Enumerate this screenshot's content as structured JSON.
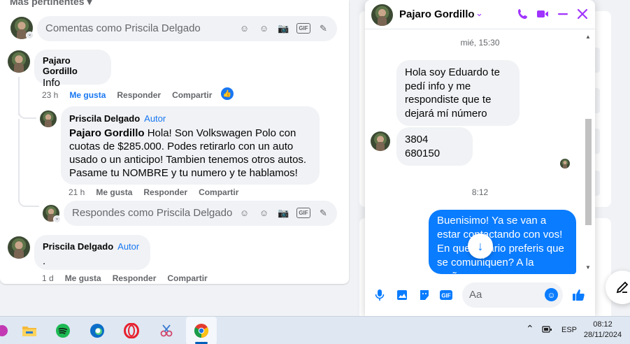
{
  "comments": {
    "sort_label": "Más pertinentes",
    "top_box_placeholder": "Comentas como Priscila Delgado",
    "reply_box_placeholder": "Respondes como Priscila Delgado",
    "items": [
      {
        "name": "Pajaro Gordillo",
        "text": "Info",
        "time": "23 h",
        "like": "Me gusta",
        "reply": "Responder",
        "share": "Compartir"
      },
      {
        "name": "Priscila Delgado",
        "role": "Autor",
        "mention": "Pajaro Gordillo",
        "text": " Hola! Son Volkswagen Polo con cuotas de $285.000. Podes retirarlo con un auto usado o un anticipo! Tambien tenemos otros autos. Pasame tu NOMBRE y tu numero y te hablamos!",
        "time": "21 h",
        "like": "Me gusta",
        "reply": "Responder",
        "share": "Compartir"
      },
      {
        "name": "Priscila Delgado",
        "role": "Autor",
        "text": ".",
        "time": "1 d",
        "like": "Me gusta",
        "reply": "Responder",
        "share": "Compartir"
      }
    ]
  },
  "chat": {
    "contact_name": "Pajaro Gordillo",
    "time_1": "mié, 15:30",
    "msg_1": "Hola  soy Eduardo te pedí info y me respondiste que te dejará mí número",
    "msg_2": "3804 680150",
    "time_2": "8:12",
    "msg_3": "Buenisimo! Ya se van a estar contactando con vos! En que horario preferis que se comuniquen? A la mañana",
    "composer_placeholder": "Aa"
  },
  "taskbar": {
    "language": "ESP",
    "time": "08:12",
    "date": "28/11/2024"
  },
  "colors": {
    "accent": "#1877f2",
    "messenger_purple": "#a033ff",
    "outgoing_bubble": "#0a7cff"
  }
}
